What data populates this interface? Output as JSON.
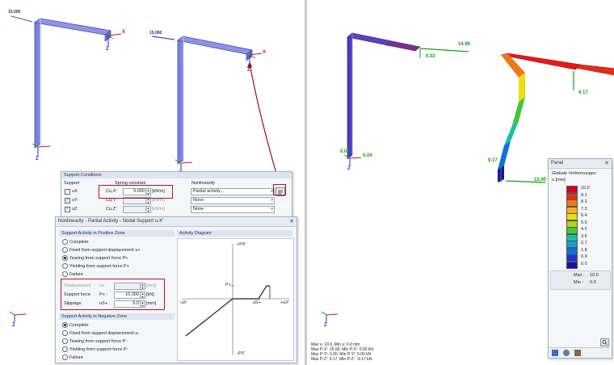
{
  "viewports": {
    "left": {
      "labels": [
        "15.000",
        "15.000"
      ]
    },
    "right": {
      "values": [
        "14.96",
        "0.02",
        "9.17",
        "0.02",
        "0.04",
        "9.17",
        "15.00"
      ]
    }
  },
  "axes": {
    "x": "X",
    "z": "Z"
  },
  "support_conditions": {
    "title": "Support Conditions",
    "col_support": "Support",
    "col_spring": "Spring constant",
    "col_nonlin": "Nonlinearity",
    "rows": [
      {
        "label": "uX:",
        "checked": false,
        "param": "Cu,X':",
        "value": "5.000",
        "unit": "[kN/m]",
        "nonlin": "Partial activity..."
      },
      {
        "label": "uY:",
        "checked": true,
        "param": "Cu,Y':",
        "value": "",
        "unit": "[kN/m]",
        "nonlin": "None"
      },
      {
        "label": "uZ:",
        "checked": true,
        "param": "Cu,Z':",
        "value": "",
        "unit": "[kN/m]",
        "nonlin": "None"
      }
    ]
  },
  "nonlinearity_dialog": {
    "title": "Nonlinearity - Partial Activity - Nodal Support u-X'",
    "positive_header": "Support Activity in Positive Zone",
    "positive_options": [
      "Complete",
      "Fixed from support displacement u+",
      "Tearing from support force P+",
      "Yielding from support force P+",
      "Failure"
    ],
    "positive_selected": 2,
    "displacement_label": "Displacement",
    "displacement_sym": "u+ :",
    "displacement_unit": "[mm]",
    "force_label": "Support force",
    "force_sym": "P+ :",
    "force_value": "10.000",
    "force_unit": "[kN]",
    "slippage_label": "Slippage",
    "slippage_sym": "uS+ :",
    "slippage_value": "5.0",
    "slippage_unit": "[mm]",
    "negative_header": "Support Activity in Negative Zone",
    "negative_options": [
      "Complete",
      "Fixed from support displacement u-",
      "Tearing from support force P-",
      "Yielding from support force P-",
      "Failure"
    ],
    "negative_selected": 0,
    "diagram_header": "Activity Diagram",
    "diagram_labels": {
      "p_top": "+PX'",
      "p_plus": "P+",
      "us_plus": "uS+",
      "ux_pos": "+uX'",
      "ux_neg": "-uX'",
      "p_bottom": "-PX'"
    }
  },
  "panel": {
    "title": "Panel",
    "subtitle": "Globale Verformungen",
    "unit": "u [mm]",
    "legend_values": [
      "10.0",
      "9.1",
      "8.2",
      "7.3",
      "6.4",
      "5.5",
      "4.5",
      "3.6",
      "2.7",
      "1.8",
      "0.9",
      "0.0"
    ],
    "legend_colors": [
      "#d4001c",
      "#e8301a",
      "#f07818",
      "#f4b418",
      "#e8e010",
      "#a8d818",
      "#40c838",
      "#18c0a0",
      "#10a0d8",
      "#1070e0",
      "#1838d0",
      "#2010a8"
    ],
    "max_label": "Max :",
    "max_value": "10.0",
    "min_label": "Min :",
    "min_value": "0.0"
  },
  "status_lines": [
    "Max u: 10.0, Min u: 0.0 mm",
    "Max P-X': 15.00, Min P-X': 0.00 kN",
    "Max P-Y': 0.00, Min P-Y': 0.00 kN",
    "Max P-Z': 9.17, Min P-Z': -9.17 kN"
  ]
}
